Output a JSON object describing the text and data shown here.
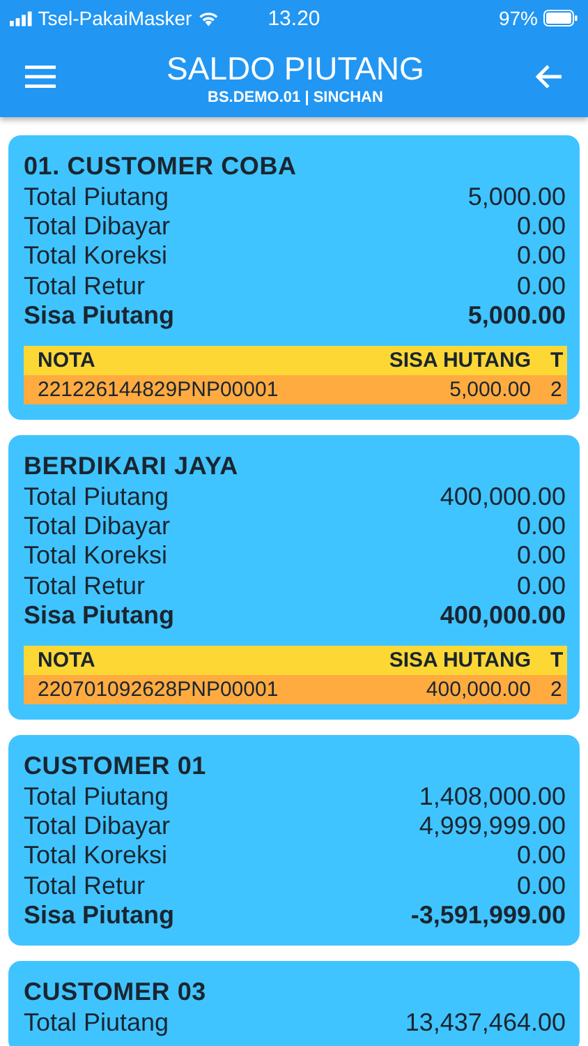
{
  "status_bar": {
    "carrier": "Tsel-PakaiMasker",
    "time": "13.20",
    "battery": "97%"
  },
  "app_bar": {
    "title": "SALDO PIUTANG",
    "subtitle": "BS.DEMO.01 | SINCHAN"
  },
  "customers": [
    {
      "name": "01. CUSTOMER COBA",
      "rows": [
        {
          "label": "Total Piutang",
          "value": "5,000.00"
        },
        {
          "label": "Total Dibayar",
          "value": "0.00"
        },
        {
          "label": "Total Koreksi",
          "value": "0.00"
        },
        {
          "label": "Total Retur",
          "value": "0.00"
        }
      ],
      "sisa": {
        "label": "Sisa Piutang",
        "value": "5,000.00"
      },
      "table": {
        "columns": [
          "NOTA",
          "SISA HUTANG",
          "T"
        ],
        "rows": [
          [
            "221226144829PNP00001",
            "5,000.00",
            "2"
          ]
        ]
      }
    },
    {
      "name": "BERDIKARI JAYA",
      "rows": [
        {
          "label": "Total Piutang",
          "value": "400,000.00"
        },
        {
          "label": "Total Dibayar",
          "value": "0.00"
        },
        {
          "label": "Total Koreksi",
          "value": "0.00"
        },
        {
          "label": "Total Retur",
          "value": "0.00"
        }
      ],
      "sisa": {
        "label": "Sisa Piutang",
        "value": "400,000.00"
      },
      "table": {
        "columns": [
          "NOTA",
          "SISA HUTANG",
          "T"
        ],
        "rows": [
          [
            "220701092628PNP00001",
            "400,000.00",
            "2"
          ]
        ]
      }
    },
    {
      "name": "CUSTOMER 01",
      "rows": [
        {
          "label": "Total Piutang",
          "value": "1,408,000.00"
        },
        {
          "label": "Total Dibayar",
          "value": "4,999,999.00"
        },
        {
          "label": "Total Koreksi",
          "value": "0.00"
        },
        {
          "label": "Total Retur",
          "value": "0.00"
        }
      ],
      "sisa": {
        "label": "Sisa Piutang",
        "value": "-3,591,999.00"
      }
    },
    {
      "name": "CUSTOMER 03",
      "rows": [
        {
          "label": "Total Piutang",
          "value": "13,437,464.00"
        }
      ]
    }
  ]
}
